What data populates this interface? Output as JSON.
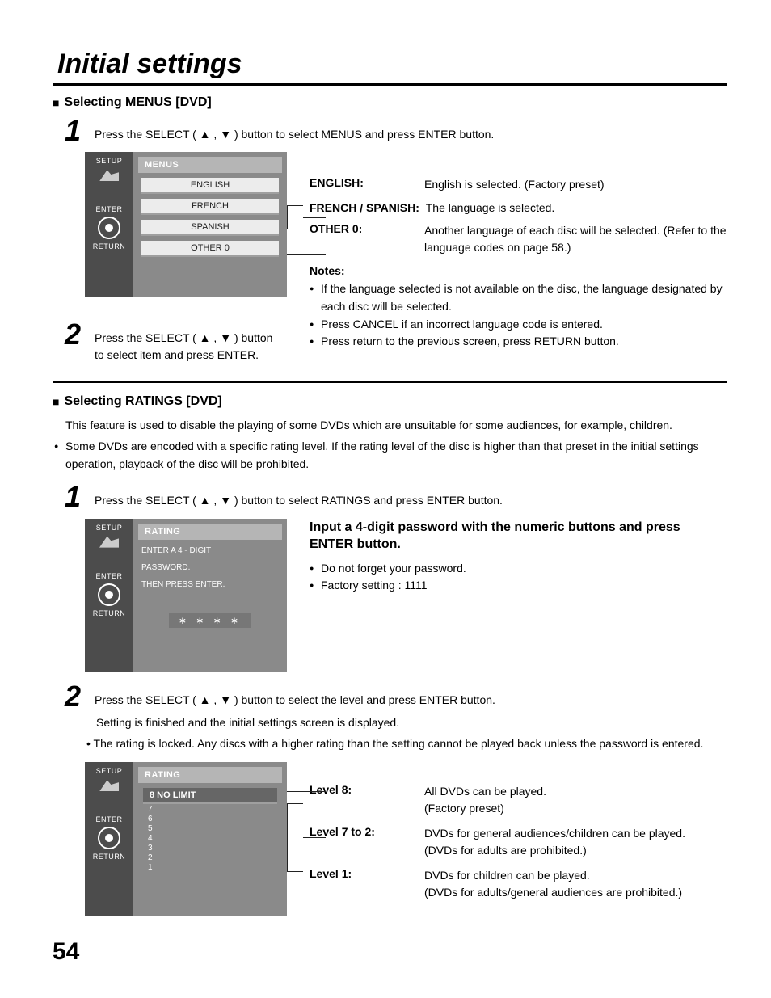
{
  "page": {
    "title": "Initial settings",
    "number": "54"
  },
  "section_menus": {
    "heading": "Selecting MENUS [DVD]",
    "step1": "Press the SELECT ( ▲ , ▼ ) button to select MENUS and press ENTER button.",
    "step2": "Press the SELECT ( ▲ , ▼ ) button to select item and press ENTER.",
    "osd": {
      "setup": "SETUP",
      "enter": "ENTER",
      "return": "RETURN",
      "header": "MENUS",
      "items": [
        "ENGLISH",
        "FRENCH",
        "SPANISH",
        "OTHER   0"
      ]
    },
    "defs": [
      {
        "term": "ENGLISH:",
        "desc": "English is selected. (Factory preset)"
      },
      {
        "term": "FRENCH / SPANISH:",
        "desc": "The language is selected."
      },
      {
        "term": "OTHER 0:",
        "desc": "Another language of each disc will be selected. (Refer to the language codes on page 58.)"
      }
    ],
    "notes_title": "Notes:",
    "notes": [
      "If the language selected is not available on the disc, the language designated by each disc will be selected.",
      "Press CANCEL if an incorrect language code is entered.",
      "Press return to the previous screen, press RETURN button."
    ]
  },
  "section_ratings": {
    "heading": "Selecting RATINGS [DVD]",
    "intro1": "This feature is used to disable the playing of some DVDs which are unsuitable for some audiences, for example, children.",
    "intro2": "Some DVDs are encoded with a specific rating level. If the rating level of the disc is higher than that preset in the initial settings operation, playback of the disc will be prohibited.",
    "step1": "Press the SELECT ( ▲ , ▼ ) button to select RATINGS and press ENTER button.",
    "osd_pw": {
      "setup": "SETUP",
      "enter": "ENTER",
      "return": "RETURN",
      "header": "RATING",
      "line1": "ENTER  A  4 - DIGIT",
      "line2": "PASSWORD.",
      "line3": "THEN  PRESS  ENTER.",
      "stars": "∗ ∗ ∗ ∗"
    },
    "pw_head": "Input a 4-digit password with the numeric buttons and press ENTER button.",
    "pw_notes": [
      "Do not forget your password.",
      "Factory setting : 1111"
    ],
    "step2": "Press the SELECT ( ▲ , ▼ ) button to select the level and press ENTER button.",
    "finish1": "Setting is finished and the initial settings screen is displayed.",
    "finish2": "The rating is locked. Any discs with a higher rating than the setting cannot be played back unless the password is entered.",
    "osd_lvl": {
      "header": "RATING",
      "items": [
        "8  NO  LIMIT",
        "7",
        "6",
        "5",
        "4",
        "3",
        "2",
        "1"
      ]
    },
    "levels": [
      {
        "term": "Level 8:",
        "desc": "All DVDs can be played.\n(Factory preset)"
      },
      {
        "term": "Level 7 to 2:",
        "desc": "DVDs for general audiences/children can be played.\n(DVDs for adults are prohibited.)"
      },
      {
        "term": "Level 1:",
        "desc": "DVDs for children can be played.\n(DVDs for adults/general audiences are prohibited.)"
      }
    ]
  }
}
